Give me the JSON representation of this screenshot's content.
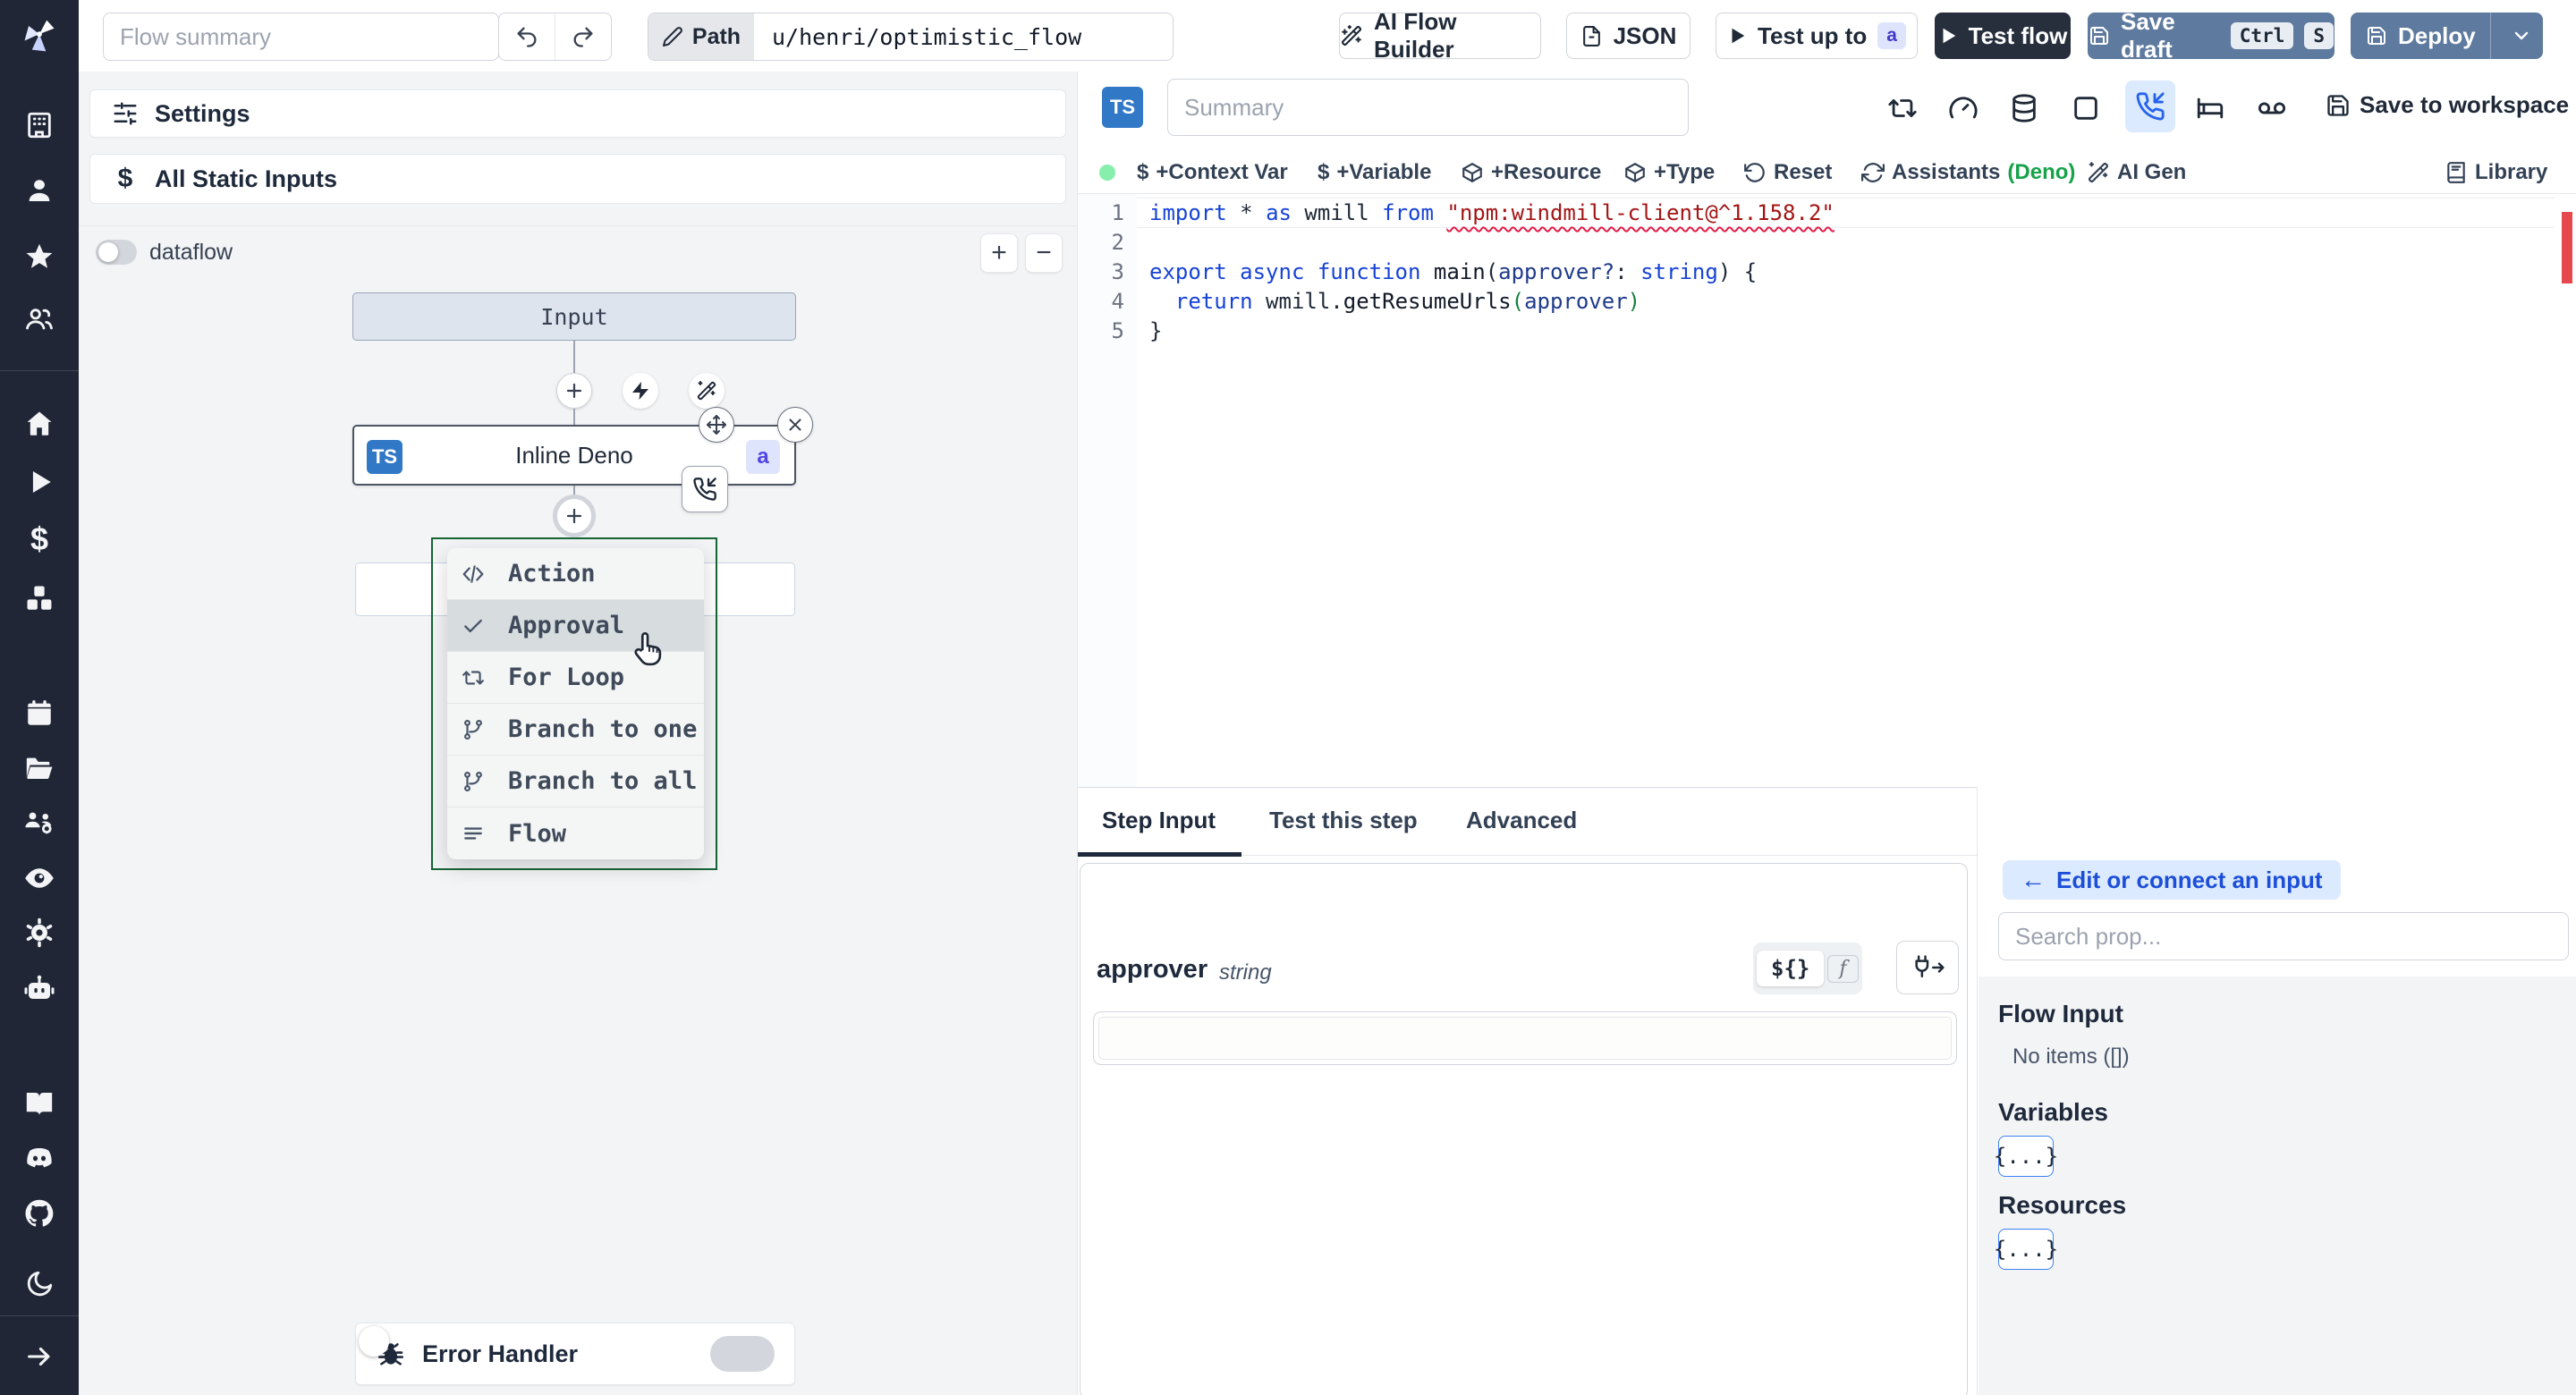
{
  "header": {
    "flow_summary_placeholder": "Flow summary",
    "path_label": "Path",
    "path_value": "u/henri/optimistic_flow",
    "buttons": {
      "ai_flow_builder": "AI Flow Builder",
      "json": "JSON",
      "test_up_to": "Test up to",
      "test_up_to_key": "a",
      "test_flow": "Test flow",
      "save_draft": "Save draft",
      "save_draft_keys": [
        "Ctrl",
        "S"
      ],
      "deploy": "Deploy"
    }
  },
  "left_panel": {
    "settings_label": "Settings",
    "all_static_inputs_label": "All Static Inputs",
    "dataflow_label": "dataflow",
    "zoom_in": "+",
    "zoom_out": "−",
    "graph": {
      "input_node_label": "Input",
      "step_node_label": "Inline Deno",
      "step_lang_badge": "TS",
      "step_id_badge": "a"
    },
    "insert_menu": {
      "highlighted": "Approval",
      "items": [
        {
          "label": "Action",
          "icon": "code-icon"
        },
        {
          "label": "Approval",
          "icon": "check-icon"
        },
        {
          "label": "For Loop",
          "icon": "repeat-icon"
        },
        {
          "label": "Branch to one",
          "icon": "git-branch-icon"
        },
        {
          "label": "Branch to all",
          "icon": "git-branch-icon"
        },
        {
          "label": "Flow",
          "icon": "flow-lines-icon"
        }
      ]
    },
    "error_handler_label": "Error Handler"
  },
  "editor": {
    "lang_badge": "TS",
    "summary_placeholder": "Summary",
    "save_to_workspace": "Save to workspace",
    "actions": {
      "context_var": "+Context Var",
      "variable": "+Variable",
      "resource": "+Resource",
      "type": "+Type",
      "reset": "Reset",
      "assistants": "Assistants",
      "assistants_mode": "(Deno)",
      "ai_gen": "AI Gen",
      "library": "Library"
    },
    "code": {
      "numbers": [
        "1",
        "2",
        "3",
        "4",
        "5"
      ],
      "lines": [
        [
          {
            "t": "import",
            "c": "kw"
          },
          {
            "t": " * ",
            "c": "pl"
          },
          {
            "t": "as",
            "c": "kw"
          },
          {
            "t": " wmill ",
            "c": "pl"
          },
          {
            "t": "from",
            "c": "kw"
          },
          {
            "t": " ",
            "c": "pl"
          },
          {
            "t": "\"npm:windmill-client@^1.158.2\"",
            "c": "str-err"
          }
        ],
        [],
        [
          {
            "t": "export",
            "c": "kw"
          },
          {
            "t": " ",
            "c": "pl"
          },
          {
            "t": "async",
            "c": "kw"
          },
          {
            "t": " ",
            "c": "pl"
          },
          {
            "t": "function",
            "c": "kw"
          },
          {
            "t": " ",
            "c": "pl"
          },
          {
            "t": "main",
            "c": "fn"
          },
          {
            "t": "(",
            "c": "pl"
          },
          {
            "t": "approver?",
            "c": "param"
          },
          {
            "t": ": ",
            "c": "pl"
          },
          {
            "t": "string",
            "c": "type"
          },
          {
            "t": ") {",
            "c": "pl"
          }
        ],
        [
          {
            "t": "  ",
            "c": "pl"
          },
          {
            "t": "return",
            "c": "kw"
          },
          {
            "t": " wmill.",
            "c": "pl"
          },
          {
            "t": "getResumeUrls",
            "c": "fn"
          },
          {
            "t": "(",
            "c": "paren"
          },
          {
            "t": "approver",
            "c": "param"
          },
          {
            "t": ")",
            "c": "paren"
          }
        ],
        [
          {
            "t": "}",
            "c": "pl"
          }
        ]
      ]
    }
  },
  "step_panel": {
    "tabs": [
      {
        "label": "Step Input"
      },
      {
        "label": "Test this step"
      },
      {
        "label": "Advanced"
      }
    ],
    "active_tab": "Step Input",
    "field": {
      "name": "approver",
      "type": "string"
    },
    "expr_toggle": "${}",
    "fn_toggle": "f"
  },
  "props_panel": {
    "edit_connect_label": "Edit or connect an input",
    "search_placeholder": "Search prop...",
    "sections": {
      "flow_input_title": "Flow Input",
      "flow_input_empty": "No items ([])",
      "variables_title": "Variables",
      "variables_chip": "{...}",
      "resources_title": "Resources",
      "resources_chip": "{...}"
    }
  },
  "colors": {
    "rail_bg": "#202636",
    "steel_blue": "#5e7a9f",
    "dark_navy": "#272f3d",
    "ts_badge_blue": "#3178c6",
    "menu_border_green": "#166534",
    "assistants_green": "#16a34a",
    "suspend_highlight": "#dbeafe",
    "error_marker": "#e5484d",
    "badge_indigo_bg": "#dfe4fd"
  }
}
